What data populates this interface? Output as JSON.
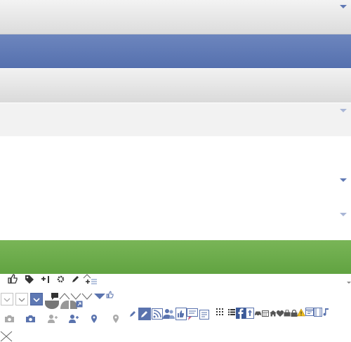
{
  "sprite_rows": {
    "row1": [
      "like-icon",
      "tag-icon",
      "plus-one-icon",
      "gear-icon",
      "pencil-icon",
      "add-list-icon"
    ],
    "row2": [
      "dropdown-outline",
      "dropdown-outline",
      "dropdown-selected",
      "chat-bubble-icon",
      "chevron-up-icon",
      "chevron-down-icon",
      "chevron-down-icon",
      "filled-triangle-icon",
      "like-icon"
    ],
    "row3": [
      "camera-icon",
      "camera-icon",
      "add-friend-icon",
      "add-friend-icon",
      "map-pin-icon",
      "map-pin-icon",
      "pencil-icon",
      "pencil-box-icon",
      "rss-icon",
      "friends-icon",
      "like-page-icon",
      "message-icon",
      "note-icon",
      "grid-icon",
      "list-icon",
      "facebook-icon",
      "upload-icon",
      "car-icon",
      "calendar-icon",
      "home-icon",
      "heart-icon",
      "bag-icon",
      "lock-icon",
      "warning-icon",
      "window-icon",
      "film-icon",
      "music-note-icon"
    ],
    "row4": [
      "close-x-icon"
    ]
  },
  "colors": {
    "blue_band": "#5a73ae",
    "green_band": "#68a94a",
    "gray_band": "#dcdcdc",
    "icon_blue": "#5a73ae"
  }
}
